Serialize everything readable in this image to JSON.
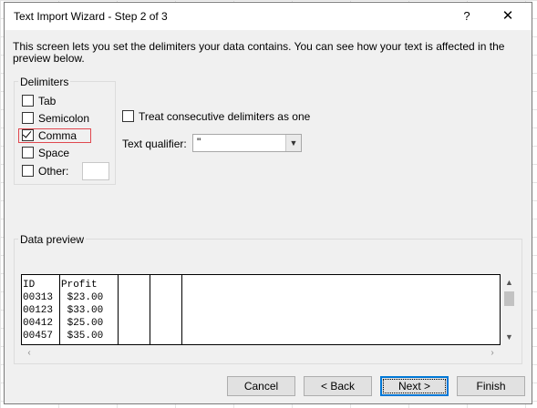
{
  "dialog": {
    "title": "Text Import Wizard - Step 2 of 3",
    "help_glyph": "?",
    "close_glyph": "✕",
    "description": "This screen lets you set the delimiters your data contains.  You can see how your text is affected in the preview below."
  },
  "delimiters": {
    "group_title": "Delimiters",
    "options": [
      {
        "label": "Tab",
        "checked": false
      },
      {
        "label": "Semicolon",
        "checked": false
      },
      {
        "label": "Comma",
        "checked": true
      },
      {
        "label": "Space",
        "checked": false
      },
      {
        "label": "Other:",
        "checked": false
      }
    ],
    "other_value": ""
  },
  "treat_consecutive": {
    "label": "Treat consecutive delimiters as one",
    "checked": false
  },
  "text_qualifier": {
    "label": "Text qualifier:",
    "value": "\""
  },
  "preview": {
    "group_title": "Data preview",
    "rows": [
      [
        "ID",
        "Profit"
      ],
      [
        "00313",
        " $23.00"
      ],
      [
        "00123",
        " $33.00"
      ],
      [
        "00412",
        " $25.00"
      ],
      [
        "00457",
        " $35.00"
      ]
    ]
  },
  "buttons": {
    "cancel": "Cancel",
    "back": "< Back",
    "next": "Next >",
    "finish": "Finish"
  },
  "icons": {
    "scroll_up": "scroll-up-icon",
    "scroll_down": "scroll-down-icon",
    "scroll_left": "scroll-left-icon",
    "scroll_right": "scroll-right-icon",
    "dropdown": "chevron-down-icon",
    "check": "checkmark-icon"
  }
}
